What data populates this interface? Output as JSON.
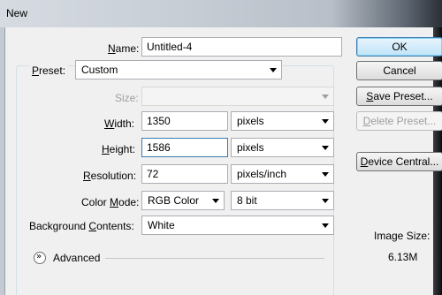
{
  "window": {
    "title": "New"
  },
  "name": {
    "label": "Name:",
    "value": "Untitled-4"
  },
  "preset": {
    "label": "Preset:",
    "value": "Custom"
  },
  "size": {
    "label": "Size:",
    "value": ""
  },
  "width": {
    "label": "Width:",
    "value": "1350",
    "unit": "pixels"
  },
  "height": {
    "label": "Height:",
    "value": "1586",
    "unit": "pixels"
  },
  "resolution": {
    "label": "Resolution:",
    "value": "72",
    "unit": "pixels/inch"
  },
  "color_mode": {
    "label": "Color Mode:",
    "value": "RGB Color",
    "depth": "8 bit"
  },
  "background": {
    "label": "Background Contents:",
    "value": "White"
  },
  "advanced": {
    "label": "Advanced"
  },
  "buttons": {
    "ok": "OK",
    "cancel": "Cancel",
    "save_preset": "Save Preset...",
    "delete_preset": "Delete Preset...",
    "device_central": "Device Central..."
  },
  "image_size": {
    "label": "Image Size:",
    "value": "6.13M"
  }
}
